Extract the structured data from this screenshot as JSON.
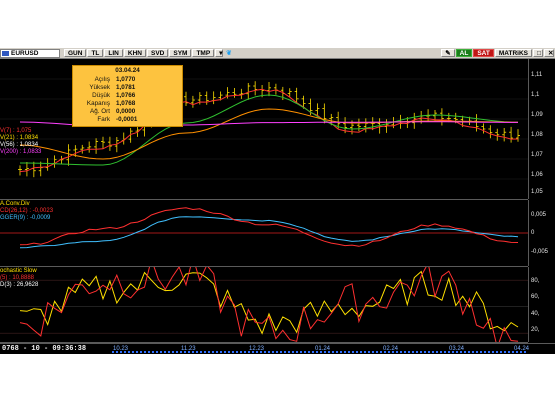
{
  "toolbar": {
    "symbol": "EURUSD",
    "buttons": [
      "GUN",
      "TL",
      "LIN",
      "KHN",
      "SVD",
      "SYM",
      "TMP"
    ],
    "buy_label": "AL",
    "sell_label": "SAT",
    "matrix_label": "MATRiKS",
    "icons": [
      "chart-icon",
      "dropdown-icon",
      "twitter-icon",
      "settings-icon",
      "window-icon",
      "close-icon"
    ]
  },
  "tooltip": {
    "date": "03.04.24",
    "rows": [
      {
        "label": "Açılış",
        "value": "1,0770"
      },
      {
        "label": "Yüksek",
        "value": "1,0781"
      },
      {
        "label": "Düşük",
        "value": "1,0766"
      },
      {
        "label": "Kapanış",
        "value": "1,0768"
      },
      {
        "label": "Ağ. Ort",
        "value": "0,0000"
      },
      {
        "label": "Fark",
        "value": "-0,0001"
      }
    ]
  },
  "legends": {
    "price": [
      {
        "text": "V(7)   : 1,075",
        "color": "#ff3030"
      },
      {
        "text": "V(21)  : 1,0834",
        "color": "#ffe000"
      },
      {
        "text": "V(56)  : 1,0834",
        "color": "#ffffff"
      },
      {
        "text": "V(200) : 1,0833",
        "color": "#ff40ff"
      }
    ],
    "macd": [
      {
        "text": "A.Conv.Div",
        "color": "#ffe000"
      },
      {
        "text": "CD(26,12)  : -0,0023",
        "color": "#ff3030"
      },
      {
        "text": "GGER(9)   : -0,0009",
        "color": "#40c0ff"
      }
    ],
    "stoch": [
      {
        "text": "ochastic Slow",
        "color": "#ffe000"
      },
      {
        "text": "(5)   : 10,8888",
        "color": "#ff3030"
      },
      {
        "text": "D(3)   : 26,9628",
        "color": "#ffffff"
      }
    ]
  },
  "axes": {
    "price_ticks": [
      "1,11",
      "1,1",
      "1,09",
      "1,08",
      "1,07",
      "1,06",
      "1,05"
    ],
    "macd_ticks": [
      "0,005",
      "0",
      "-0,005"
    ],
    "stoch_ticks": [
      "80,",
      "60,",
      "40,",
      "20,"
    ]
  },
  "status": "0768 - 10 - 09:36:38",
  "x_labels": [
    "10.23",
    "11.23",
    "12.23",
    "01.24",
    "02.24",
    "03.24",
    "04.24"
  ],
  "colors": {
    "background": "#000000",
    "candle": "#ffe000",
    "sma_short": "#ff3030",
    "sma_mid": "#30c030",
    "sma_long": "#ff9000",
    "sma_200": "#ff40ff",
    "macd_line": "#ff3030",
    "signal_line": "#40c0ff",
    "stoch_k": "#ff3030",
    "stoch_d": "#ffe000",
    "zero_line": "#d82020"
  },
  "chart_data": [
    {
      "type": "line",
      "title": "EURUSD",
      "x": [
        "10.23",
        "11.23",
        "12.23",
        "01.24",
        "02.24",
        "03.24",
        "04.24"
      ],
      "close": [
        1.0598,
        1.0728,
        1.0946,
        1.1004,
        1.0815,
        1.0861,
        1.0768
      ],
      "ylim": [
        1.045,
        1.115
      ],
      "series": [
        {
          "name": "V(7)",
          "values": [
            1.059,
            1.071,
            1.093,
            1.099,
            1.079,
            1.085,
            1.075
          ]
        },
        {
          "name": "V(21)",
          "values": [
            1.063,
            1.062,
            1.083,
            1.097,
            1.08,
            1.087,
            1.0834
          ]
        },
        {
          "name": "V(56)",
          "values": [
            1.072,
            1.065,
            1.078,
            1.09,
            1.083,
            1.084,
            1.0834
          ]
        },
        {
          "name": "V(200)",
          "values": [
            1.0835,
            1.0816,
            1.082,
            1.0832,
            1.0834,
            1.0836,
            1.0833
          ]
        }
      ]
    },
    {
      "type": "line",
      "title": "A.Conv.Div",
      "x": [
        "10.23",
        "11.23",
        "12.23",
        "01.24",
        "02.24",
        "03.24",
        "04.24"
      ],
      "ylim": [
        -0.008,
        0.008
      ],
      "series": [
        {
          "name": "CD(26,12)",
          "values": [
            -0.003,
            0.001,
            0.006,
            0.002,
            -0.003,
            0.002,
            -0.0023
          ]
        },
        {
          "name": "GGER(9)",
          "values": [
            -0.0035,
            -0.002,
            0.004,
            0.003,
            -0.002,
            0.001,
            -0.0009
          ]
        }
      ]
    },
    {
      "type": "line",
      "title": "ochastic Slow",
      "x": [
        "10.23",
        "11.23",
        "12.23",
        "01.24",
        "02.24",
        "03.24",
        "04.24"
      ],
      "ylim": [
        10,
        95
      ],
      "series": [
        {
          "name": "(5)",
          "values": [
            30,
            80,
            85,
            20,
            55,
            80,
            10.8888
          ]
        },
        {
          "name": "D(3)",
          "values": [
            35,
            70,
            82,
            30,
            50,
            75,
            26.9628
          ]
        }
      ]
    }
  ]
}
